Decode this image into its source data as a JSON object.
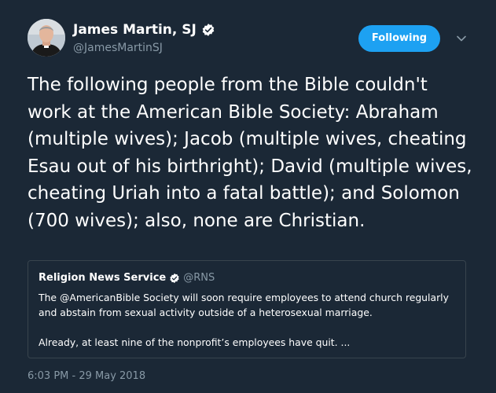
{
  "author": {
    "name": "James Martin, SJ",
    "handle": "@JamesMartinSJ",
    "verified": true
  },
  "follow_button": {
    "label": "Following"
  },
  "tweet": {
    "text": "The following people from the Bible couldn't work at the American Bible Society: Abraham (multiple wives); Jacob (multiple wives, cheating Esau out of his birthright); David (multiple wives, cheating Uriah into a fatal battle); and Solomon (700 wives); also, none are Christian.",
    "timestamp": "6:03 PM - 29 May 2018"
  },
  "quoted_tweet": {
    "name": "Religion News Service",
    "handle": "@RNS",
    "verified": true,
    "paragraph_1": "The @AmericanBible Society will soon require employees to attend church regularly and abstain from sexual activity outside of a heterosexual marriage.",
    "paragraph_2": "Already, at least nine of the nonprofit’s employees have quit. ..."
  },
  "colors": {
    "background": "#1b2836",
    "accent": "#1da1f2",
    "secondary_text": "#8899a6",
    "border": "#38444d"
  },
  "icons": {
    "verified": "verified-badge-icon",
    "caret": "chevron-down-icon"
  }
}
